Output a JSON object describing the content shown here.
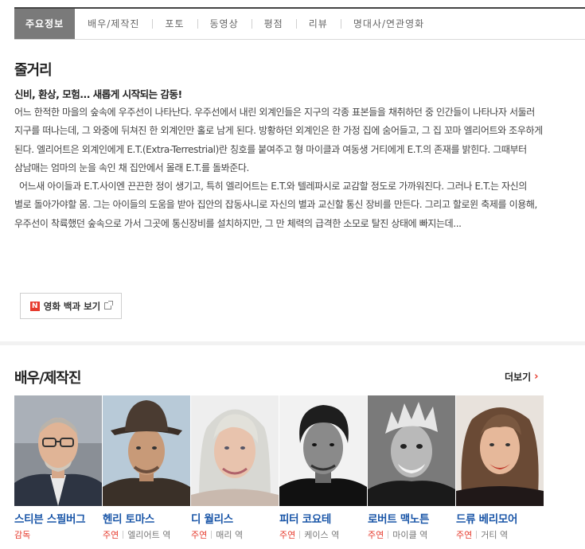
{
  "tabs": [
    "주요정보",
    "배우/제작진",
    "포토",
    "동영상",
    "평점",
    "리뷰",
    "명대사/연관영화"
  ],
  "synopsis": {
    "title": "줄거리",
    "tagline": "신비, 환상, 모험... 새롭게 시작되는 감동!",
    "paragraph1": "어느 한적한 마을의 숲속에 우주선이 나타난다. 우주선에서 내린 외계인들은 지구의 각종 표본들을 채취하던 중 인간들이 나타나자 서둘러 지구를 떠나는데, 그 와중에 뒤쳐진 한 외계인만 홀로 남게 된다. 방황하던 외계인은 한 가정 집에 숨어들고, 그 집 꼬마 엘리어트와 조우하게 된다. 엘리어트은 외계인에게 E.T.(Extra-Terrestrial)란 칭호를 붙여주고 형 마이클과 여동생 거티에게 E.T.의 존재를 밝힌다. 그때부터 삼남매는 엄마의 눈을 속인 채 집안에서 몰래 E.T.를 돌봐준다.",
    "paragraph2": "어느새 아이들과 E.T.사이엔 끈끈한 정이 생기고, 특히 엘리어트는 E.T.와 텔레파시로 교감할 정도로 가까워진다. 그러나 E.T.는 자신의 별로 돌아가야할 몸. 그는 아이들의 도움을 받아 집안의 잡동사니로 자신의 별과 교신할 통신 장비를 만든다. 그리고 할로윈 축제를 이용해, 우주선이 착륙했던 숲속으로 가서 그곳에 통신장비를 설치하지만, 그 만 체력의 급격한 소모로 탈진 상태에 빠지는데...",
    "ency_button": "영화 백과 보기",
    "n_badge": "N"
  },
  "cast": {
    "title": "배우/제작진",
    "more": "더보기",
    "members": [
      {
        "name": "스티븐 스필버그",
        "role": "감독",
        "character": ""
      },
      {
        "name": "헨리 토마스",
        "role": "주연",
        "character": "엘리어트 역"
      },
      {
        "name": "디 월리스",
        "role": "주연",
        "character": "매리 역"
      },
      {
        "name": "피터 코요테",
        "role": "주연",
        "character": "케이스 역"
      },
      {
        "name": "로버트 맥노튼",
        "role": "주연",
        "character": "마이클 역"
      },
      {
        "name": "드류 베리모어",
        "role": "주연",
        "character": "거티 역"
      }
    ]
  },
  "colors": {
    "accent": "#e63b2e",
    "link": "#1a56a8",
    "active_tab": "#7a7a7a"
  }
}
